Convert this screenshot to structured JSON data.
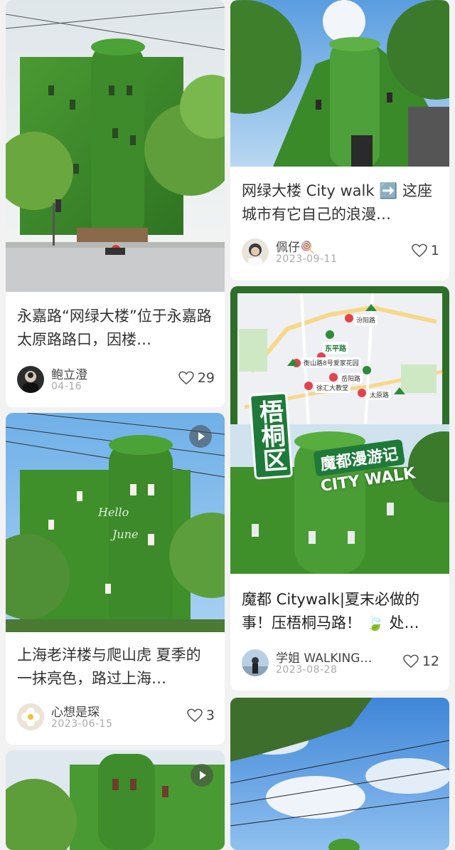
{
  "feed": {
    "cards": [
      {
        "title": "永嘉路“网绿大楼”位于永嘉路太原路路口，因楼…",
        "author": "鲍立澄",
        "date": "04-16",
        "likes": "29",
        "avatar_icon": "person-avatar-icon"
      },
      {
        "title": "网绿大楼 City walk ➡️ 这座城市有它自己的浪漫…",
        "author": "佩仔🍭",
        "date": "2023-09-11",
        "likes": "1",
        "avatar_icon": "person-avatar-icon"
      },
      {
        "title": "魔都 Citywalk|夏末必做的事！压梧桐马路！ 🍃 处…",
        "author": "学姐 WALKING…",
        "date": "2023-08-28",
        "likes": "12",
        "avatar_icon": "person-avatar-icon",
        "overlay": {
          "district": "梧桐区",
          "banner_top": "魔都漫游记",
          "banner_bottom": "CITY WALK",
          "map_labels": [
            "汾阳路",
            "东平路",
            "衡山路8号爱家花园",
            "岳阳路",
            "徐汇大教堂",
            "太原路"
          ]
        }
      },
      {
        "title": "上海老洋楼与爬山虎 夏季的一抹亮色，路过上海…",
        "author": "心想是琛",
        "date": "2023-06-15",
        "likes": "3",
        "avatar_icon": "flower-avatar-icon",
        "image_text": "Hello June"
      }
    ]
  },
  "colors": {
    "background": "#f2f2f2",
    "ivy_green": "#3f8f2a",
    "sky_blue": "#7fb6e6",
    "brand_green": "#1f7a3a"
  }
}
